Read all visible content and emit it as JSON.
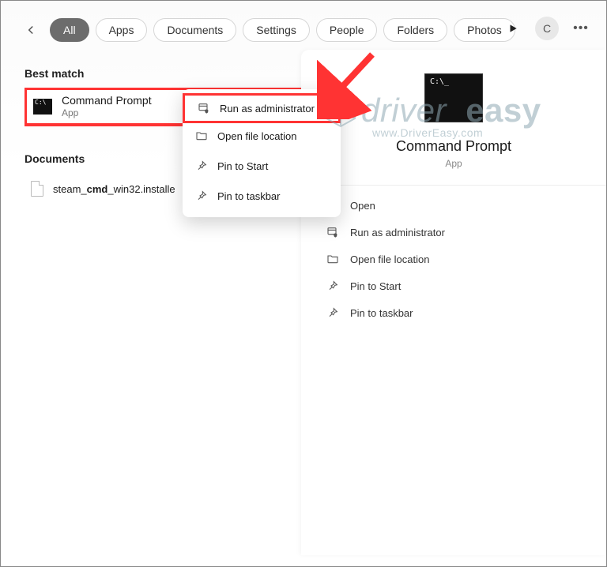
{
  "topbar": {
    "tabs": [
      "All",
      "Apps",
      "Documents",
      "Settings",
      "People",
      "Folders",
      "Photos"
    ],
    "active_tab_index": 0,
    "avatar_initial": "C"
  },
  "sections": {
    "best_match_heading": "Best match",
    "documents_heading": "Documents"
  },
  "best_match": {
    "title": "Command Prompt",
    "subtitle": "App"
  },
  "documents": {
    "file_name_html": "steam_<b>cmd</b>_win32.installe"
  },
  "context_menu": {
    "items": [
      {
        "label": "Run as administrator",
        "icon": "admin-window-icon"
      },
      {
        "label": "Open file location",
        "icon": "folder-icon"
      },
      {
        "label": "Pin to Start",
        "icon": "pin-icon"
      },
      {
        "label": "Pin to taskbar",
        "icon": "pin-icon"
      }
    ],
    "highlight_index": 0
  },
  "details": {
    "title": "Command Prompt",
    "subtitle": "App",
    "actions": [
      {
        "label": "Open",
        "icon": "open-icon"
      },
      {
        "label": "Run as administrator",
        "icon": "admin-window-icon"
      },
      {
        "label": "Open file location",
        "icon": "folder-icon"
      },
      {
        "label": "Pin to Start",
        "icon": "pin-icon"
      },
      {
        "label": "Pin to taskbar",
        "icon": "pin-icon"
      }
    ]
  },
  "watermark": {
    "brand_part1": "driver",
    "brand_part2": "easy",
    "url": "www.DriverEasy.com"
  },
  "annotation": {
    "highlight_color": "#ff3333"
  }
}
